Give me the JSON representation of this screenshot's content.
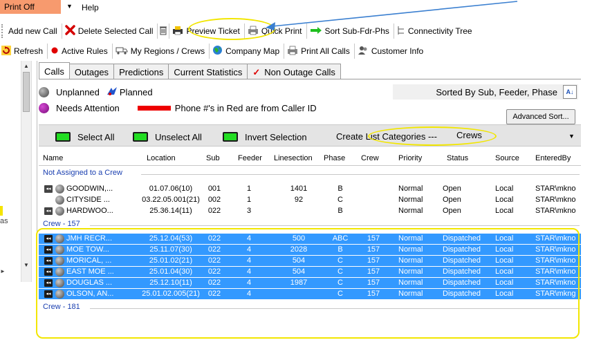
{
  "menu": {
    "print_off": "Print Off",
    "help": "Help"
  },
  "toolbar1": {
    "add_new_call": "Add new Call",
    "delete_selected_call": "Delete Selected Call",
    "preview_ticket": "Preview Ticket",
    "quick_print": "Quick Print",
    "sort_sub_fdr_phs": "Sort  Sub-Fdr-Phs",
    "connectivity_tree": "Connectivity Tree"
  },
  "toolbar2": {
    "refresh": "Refresh",
    "active_rules": "Active Rules",
    "my_regions_crews": "My Regions / Crews",
    "company_map": "Company Map",
    "print_all_calls": "Print All Calls",
    "customer_info": "Customer Info"
  },
  "left_panel": {
    "fragment_text": "as"
  },
  "tabs": [
    {
      "label": "Calls",
      "active": true
    },
    {
      "label": "Outages",
      "active": false
    },
    {
      "label": "Predictions",
      "active": false
    },
    {
      "label": "Current Statistics",
      "active": false
    },
    {
      "label": "Non Outage Calls",
      "active": false
    }
  ],
  "legend": {
    "unplanned": "Unplanned",
    "planned": "Planned",
    "needs_attention": "Needs Attention",
    "phone_red": "Phone #'s in Red are from Caller ID"
  },
  "sort": {
    "sorted_by": "Sorted By Sub, Feeder, Phase",
    "advanced_sort": "Advanced Sort..."
  },
  "selection": {
    "select_all": "Select All",
    "unselect_all": "Unselect All",
    "invert_selection": "Invert Selection",
    "create_list_categories": "Create List Categories ---",
    "category_value": "Crews"
  },
  "columns": [
    "Name",
    "Location",
    "Sub",
    "Feeder",
    "Linesection",
    "Phase",
    "Crew",
    "Priority",
    "Status",
    "Source",
    "EnteredBy"
  ],
  "groups": [
    {
      "label": "Not Assigned to a Crew",
      "selected": false,
      "rows": [
        {
          "rewind": true,
          "name": "GOODWIN,...",
          "location": "01.07.06(10)",
          "sub": "001",
          "feeder": "1",
          "linesection": "1401",
          "phase": "B",
          "crew": "",
          "priority": "Normal",
          "status": "Open",
          "source": "Local",
          "entered_by": "STAR\\mkno"
        },
        {
          "rewind": false,
          "name": "CITYSIDE ...",
          "location": "03.22.05.001(21)",
          "sub": "002",
          "feeder": "1",
          "linesection": "92",
          "phase": "C",
          "crew": "",
          "priority": "Normal",
          "status": "Open",
          "source": "Local",
          "entered_by": "STAR\\mkno"
        },
        {
          "rewind": true,
          "name": "HARDWOO...",
          "location": "25.36.14(11)",
          "sub": "022",
          "feeder": "3",
          "linesection": "",
          "phase": "B",
          "crew": "",
          "priority": "Normal",
          "status": "Open",
          "source": "Local",
          "entered_by": "STAR\\mkno"
        }
      ]
    },
    {
      "label": "Crew - 157",
      "selected": true,
      "rows": [
        {
          "rewind": true,
          "name": "JMH RECR...",
          "location": "25.12.04(53)",
          "sub": "022",
          "feeder": "4",
          "linesection": "500",
          "phase": "ABC",
          "crew": "157",
          "priority": "Normal",
          "status": "Dispatched",
          "source": "Local",
          "entered_by": "STAR\\mkno"
        },
        {
          "rewind": true,
          "name": "MOE TOW...",
          "location": "25.11.07(30)",
          "sub": "022",
          "feeder": "4",
          "linesection": "2028",
          "phase": "B",
          "crew": "157",
          "priority": "Normal",
          "status": "Dispatched",
          "source": "Local",
          "entered_by": "STAR\\mkno"
        },
        {
          "rewind": true,
          "name": "MORICAL, ...",
          "location": "25.01.02(21)",
          "sub": "022",
          "feeder": "4",
          "linesection": "504",
          "phase": "C",
          "crew": "157",
          "priority": "Normal",
          "status": "Dispatched",
          "source": "Local",
          "entered_by": "STAR\\mkno"
        },
        {
          "rewind": true,
          "name": "EAST MOE ...",
          "location": "25.01.04(30)",
          "sub": "022",
          "feeder": "4",
          "linesection": "504",
          "phase": "C",
          "crew": "157",
          "priority": "Normal",
          "status": "Dispatched",
          "source": "Local",
          "entered_by": "STAR\\mkno"
        },
        {
          "rewind": true,
          "name": "DOUGLAS ...",
          "location": "25.12.10(11)",
          "sub": "022",
          "feeder": "4",
          "linesection": "1987",
          "phase": "C",
          "crew": "157",
          "priority": "Normal",
          "status": "Dispatched",
          "source": "Local",
          "entered_by": "STAR\\mkno"
        },
        {
          "rewind": true,
          "name": "OLSON, AN...",
          "location": "25.01.02.005(21)",
          "sub": "022",
          "feeder": "4",
          "linesection": "",
          "phase": "C",
          "crew": "157",
          "priority": "Normal",
          "status": "Dispatched",
          "source": "Local",
          "entered_by": "STAR\\mkng"
        }
      ]
    },
    {
      "label": "Crew - 181",
      "selected": false,
      "rows": []
    }
  ],
  "colors": {
    "selection_blue": "#3399ff",
    "annotation_yellow": "#f2e600",
    "annotation_arrow": "#3a7fd0",
    "print_off_bg": "#f79a6e"
  }
}
